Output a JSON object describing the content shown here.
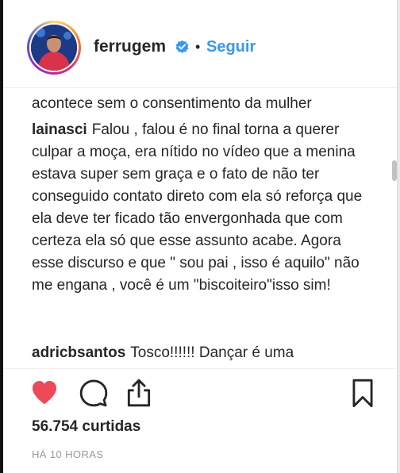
{
  "header": {
    "username": "ferrugem",
    "separator": "•",
    "follow_label": "Seguir"
  },
  "comments": [
    {
      "author": "",
      "text": "acontece sem o consentimento da mulher"
    },
    {
      "author": "lainasci",
      "text": "Falou , falou é no final torna a querer culpar a moça, era nítido no vídeo que a menina estava super sem graça e o fato de não ter conseguido contato direto com ela só reforça que ela deve ter ficado tão envergonhada que com certeza ela só que esse assunto acabe. Agora esse discurso e que \" sou pai , isso é aquilo\" não me engana , você é um \"biscoiteiro\"isso sim!"
    },
    {
      "author": "adricbsantos",
      "text": "Tosco!!!!!! Dançar é uma"
    }
  ],
  "actions": {
    "like_icon": "heart-icon",
    "comment_icon": "comment-bubble-icon",
    "share_icon": "share-icon",
    "save_icon": "bookmark-icon",
    "like_color": "#ed4956"
  },
  "post": {
    "likes": "56.754 curtidas",
    "time": "HÁ 10 HORAS"
  },
  "colors": {
    "link_blue": "#3897f0",
    "verified_blue": "#3897f0",
    "text": "#262626",
    "muted": "#999999"
  }
}
